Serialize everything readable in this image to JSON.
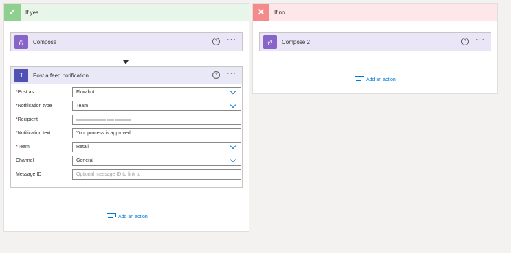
{
  "colors": {
    "yes_header": "#e8f5e9",
    "yes_icon": "#8ed08f",
    "no_header": "#fde7e9",
    "no_icon": "#f48a8a",
    "compose_icon": "#8764c7",
    "teams_icon": "#4f52b2",
    "link": "#0078d4"
  },
  "branch_yes": {
    "title": "If yes",
    "icon": "check-icon",
    "compose": {
      "title": "Compose",
      "icon": "compose-icon",
      "icon_glyph": "{⁄}",
      "help": "?",
      "more": "···"
    },
    "feed": {
      "title": "Post a feed notification",
      "icon": "teams-icon",
      "icon_glyph": "T",
      "help": "?",
      "more": "···",
      "fields": {
        "post_as": {
          "label": "Post as",
          "value": "Flow bot"
        },
        "notification_type": {
          "label": "Notification type",
          "value": "Team"
        },
        "recipient": {
          "label": "Recipient",
          "value": ""
        },
        "notification_text": {
          "label": "Notification text",
          "value": "Your process is approved"
        },
        "team": {
          "label": "Team",
          "value": "Retail"
        },
        "channel": {
          "label": "Channel",
          "value": "General"
        },
        "message_id": {
          "label": "Message ID",
          "placeholder": "Optional message ID to link to"
        }
      }
    },
    "add_action": "Add an action"
  },
  "branch_no": {
    "title": "If no",
    "icon": "close-icon",
    "compose": {
      "title": "Compose 2",
      "icon": "compose-icon",
      "icon_glyph": "{⁄}",
      "help": "?",
      "more": "···"
    },
    "add_action": "Add an action"
  }
}
